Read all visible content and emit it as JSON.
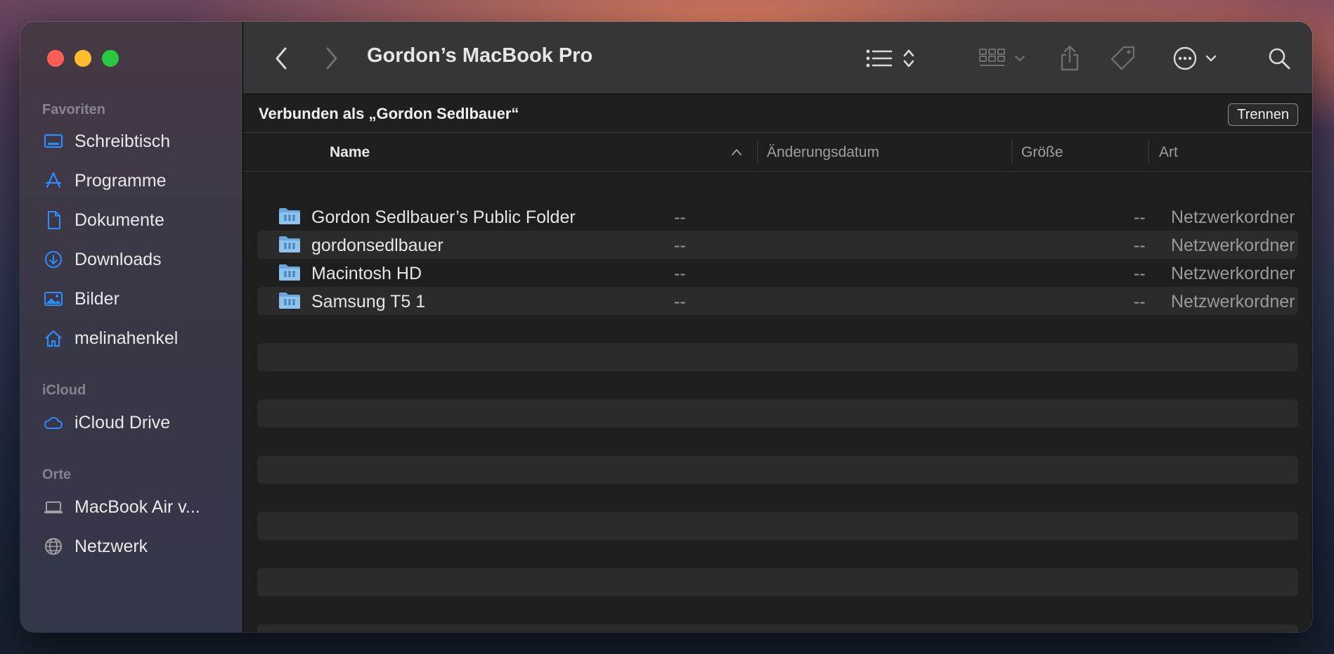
{
  "window": {
    "title": "Gordon’s MacBook Pro"
  },
  "sidebar": {
    "sections": [
      {
        "title": "Favoriten",
        "items": [
          {
            "label": "Schreibtisch",
            "icon": "desktop-icon"
          },
          {
            "label": "Programme",
            "icon": "applications-icon"
          },
          {
            "label": "Dokumente",
            "icon": "document-icon"
          },
          {
            "label": "Downloads",
            "icon": "download-icon"
          },
          {
            "label": "Bilder",
            "icon": "photo-icon"
          },
          {
            "label": "melinahenkel",
            "icon": "home-icon"
          }
        ]
      },
      {
        "title": "iCloud",
        "items": [
          {
            "label": "iCloud Drive",
            "icon": "cloud-icon"
          }
        ]
      },
      {
        "title": "Orte",
        "items": [
          {
            "label": "MacBook Air v...",
            "icon": "laptop-icon"
          },
          {
            "label": "Netzwerk",
            "icon": "globe-icon"
          }
        ]
      }
    ]
  },
  "banner": {
    "text": "Verbunden als „Gordon Sedlbauer“",
    "button_label": "Trennen"
  },
  "columns": {
    "name": "Name",
    "date": "Änderungsdatum",
    "size": "Größe",
    "kind": "Art"
  },
  "rows": [
    {
      "name": "Gordon Sedlbauer’s Public Folder",
      "date": "--",
      "size": "--",
      "kind": "Netzwerkordner"
    },
    {
      "name": "gordonsedlbauer",
      "date": "--",
      "size": "--",
      "kind": "Netzwerkordner"
    },
    {
      "name": "Macintosh HD",
      "date": "--",
      "size": "--",
      "kind": "Netzwerkordner"
    },
    {
      "name": "Samsung T5 1",
      "date": "--",
      "size": "--",
      "kind": "Netzwerkordner"
    }
  ],
  "colors": {
    "accent": "#2f8cff",
    "close": "#ff5f57",
    "minimize": "#febc2e",
    "zoom": "#28c840"
  }
}
